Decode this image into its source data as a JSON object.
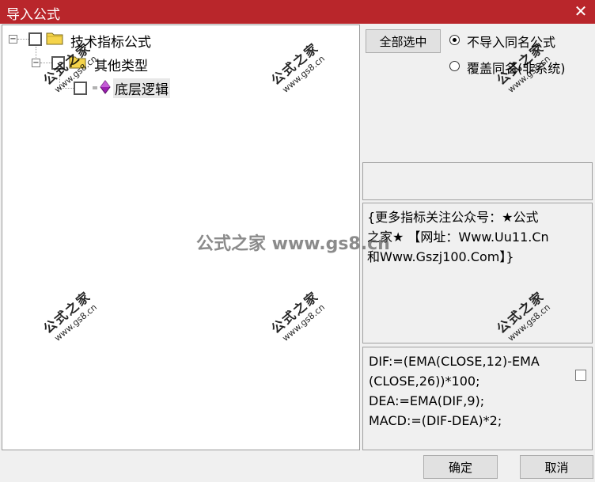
{
  "window": {
    "title": "导入公式",
    "close_glyph": "✕"
  },
  "tree": {
    "nodes": [
      {
        "label": "技术指标公式",
        "expander": "−"
      },
      {
        "label": "其他类型",
        "expander": "−"
      },
      {
        "label": "底层逻辑"
      }
    ]
  },
  "options": {
    "select_all_label": "全部选中",
    "radio_no_import": "不导入同名公式",
    "radio_overwrite": "覆盖同名(非系统)"
  },
  "info": {
    "lines": [
      "{更多指标关注公众号：★公式",
      "之家★ 【网址：Www.Uu11.Cn",
      "和Www.Gszj100.Com】}"
    ]
  },
  "formula": {
    "lines": [
      "DIF:=(EMA(CLOSE,12)-EMA",
      "(CLOSE,26))*100;",
      "DEA:=EMA(DIF,9);",
      "MACD:=(DIF-DEA)*2;"
    ]
  },
  "buttons": {
    "ok": "确定",
    "cancel": "取消"
  },
  "watermark": {
    "main": "公式之家",
    "sub": "www.gs8.cn",
    "center": "公式之家 www.gs8.cn"
  }
}
